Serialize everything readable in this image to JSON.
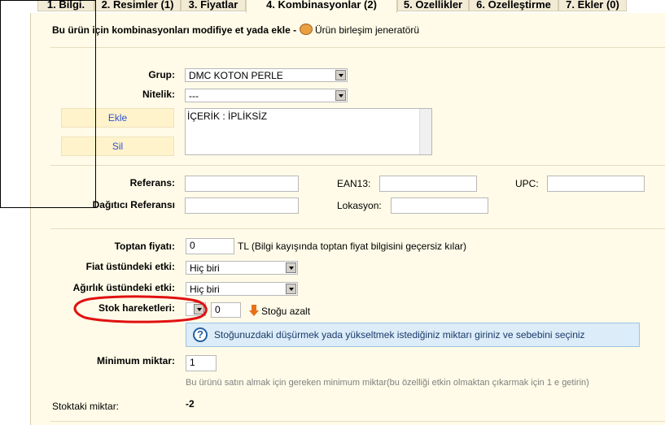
{
  "tabs": [
    {
      "label": "1. Bilgi."
    },
    {
      "label": "2. Resimler (1)"
    },
    {
      "label": "3. Fiyatlar"
    },
    {
      "label": "4. Kombinasyonlar (2)"
    },
    {
      "label": "5. Özellikler"
    },
    {
      "label": "6. Özelleştirme"
    },
    {
      "label": "7. Ekler (0)"
    }
  ],
  "header": {
    "title": "Bu ürün için kombinasyonları modifiye et yada ekle -",
    "generator_link": "Ürün birleşim jeneratörü"
  },
  "group": {
    "label": "Grup:",
    "value": "DMC KOTON PERLE"
  },
  "attribute": {
    "label": "Nitelik:",
    "value": "---"
  },
  "buttons": {
    "add": "Ekle",
    "delete": "Sil"
  },
  "combination_list": {
    "item": "İÇERİK : İPLİKSİZ"
  },
  "refs": {
    "reference_label": "Referans:",
    "reference_value": "",
    "ean13_label": "EAN13:",
    "ean13_value": "",
    "upc_label": "UPC:",
    "upc_value": "",
    "supplier_ref_label": "Dağıtıcı Referansı",
    "supplier_ref_value": "",
    "location_label": "Lokasyon:",
    "location_value": ""
  },
  "pricing": {
    "wholesale_label": "Toptan fiyatı:",
    "wholesale_value": "0",
    "wholesale_note": "TL (Bilgi kayışında toptan fiyat bilgisini geçersiz kılar)",
    "price_impact_label": "Fiat üstündeki etki:",
    "price_impact_value": "Hiç biri",
    "weight_impact_label": "Ağırlık üstündeki etki:",
    "weight_impact_value": "Hiç biri"
  },
  "stock": {
    "movement_label": "Stok hareketleri:",
    "movement_qty": "0",
    "movement_action": "Stoğu azalt",
    "hint": "Stoğunuzdaki düşürmek yada yükseltmek istediğiniz miktarı giriniz ve sebebini seçiniz",
    "min_label": "Minimum miktar:",
    "min_value": "1",
    "min_note": "Bu ürünü satın almak için gereken minimum miktar(bu özelliği etkin olmaktan çıkarmak için 1 e getirin)",
    "in_stock_label": "Stoktaki miktar:",
    "in_stock_value": "-2"
  },
  "colors": {
    "accent_orange": "#e8701a",
    "annotation_red": "#e01010",
    "panel_bg": "#fffbe8",
    "link_blue": "#3050d0"
  }
}
